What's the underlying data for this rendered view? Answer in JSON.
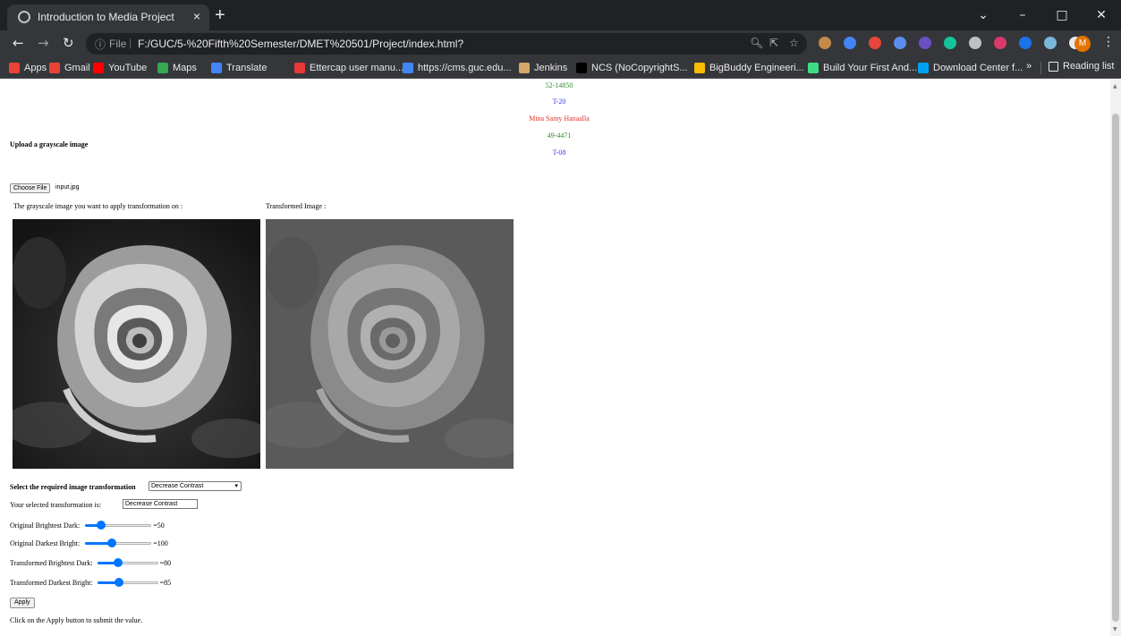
{
  "browser": {
    "tab_title": "Introduction to Media Project",
    "tab_close": "×",
    "new_tab": "+",
    "url_scheme": "File",
    "url": "F:/GUC/5-%20Fifth%20Semester/DMET%20501/Project/index.html?",
    "profile_initial": "M",
    "bookmarks": [
      {
        "label": "Apps",
        "color": "#ea4335"
      },
      {
        "label": "Gmail",
        "color": "#ea4335"
      },
      {
        "label": "YouTube",
        "color": "#ff0000"
      },
      {
        "label": "Maps",
        "color": "#34a853"
      },
      {
        "label": "Translate",
        "color": "#4285f4"
      },
      {
        "label": "Ettercap user manu...",
        "color": "#e53935"
      },
      {
        "label": "https://cms.guc.edu...",
        "color": "#4285f4"
      },
      {
        "label": "Jenkins",
        "color": "#d4a66a"
      },
      {
        "label": "NCS (NoCopyrightS...",
        "color": "#000000"
      },
      {
        "label": "BigBuddy Engineeri...",
        "color": "#fbbc04"
      },
      {
        "label": "Build Your First And...",
        "color": "#3ddc84"
      },
      {
        "label": "Download Center f...",
        "color": "#00a1f1"
      }
    ],
    "bookmarks_more": "»",
    "reading_list": "Reading list"
  },
  "header_info": [
    {
      "text": "52-14850",
      "color": "#2e8b2e"
    },
    {
      "text": "T-20",
      "color": "#3a3af0"
    },
    {
      "text": "Mina Samy Hanaalla",
      "color": "#e0302a"
    },
    {
      "text": "49-4471",
      "color": "#2e8b2e"
    },
    {
      "text": "T-08",
      "color": "#3a3af0"
    }
  ],
  "upload": {
    "heading": "Upload a grayscale image",
    "button_label": "Choose File",
    "file_name": "input.jpg"
  },
  "images": {
    "original_caption": "The grayscale image you want to apply transformation on :",
    "transformed_caption": "Transformed Image :"
  },
  "transform": {
    "select_label": "Select the required image transformation",
    "selected_option": "Decrease Contrast",
    "selected_text_label": "Your selected transformation is:",
    "selected_value": "Decrease Contrast"
  },
  "sliders": [
    {
      "label": "Original Brightest Dark:",
      "value_text": "=50",
      "value": 50,
      "max": 255
    },
    {
      "label": "Original Darkest Bright:",
      "value_text": "=100",
      "value": 100,
      "max": 255
    },
    {
      "label": "Transformed Brightest Dark:",
      "value_text": "=80",
      "value": 80,
      "max": 255
    },
    {
      "label": "Transformed Darkest Bright:",
      "value_text": "=85",
      "value": 85,
      "max": 255
    }
  ],
  "apply_label": "Apply",
  "hint": "Click on the Apply button to submit the value."
}
